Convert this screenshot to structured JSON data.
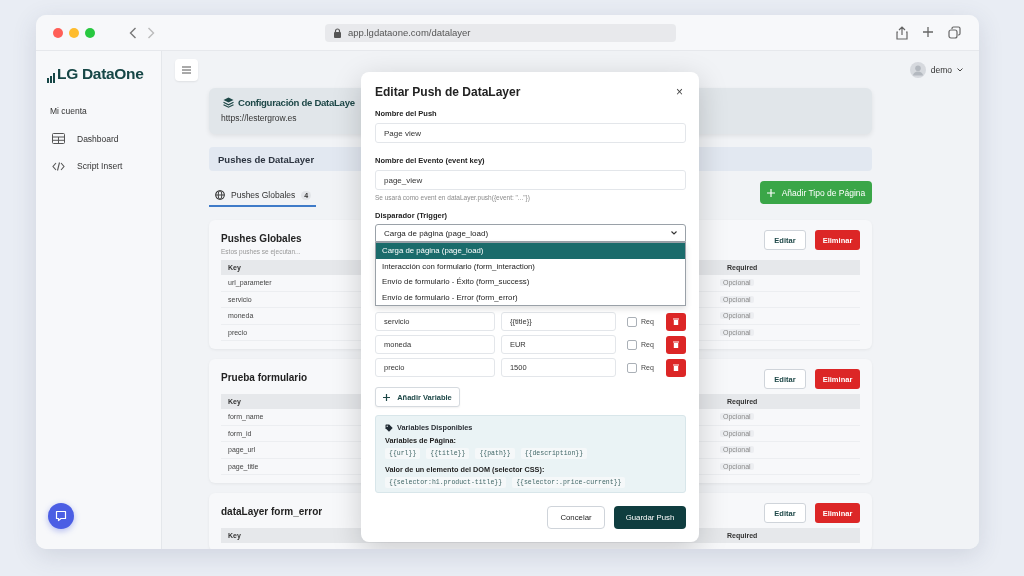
{
  "browser": {
    "url": "app.lgdataone.com/datalayer"
  },
  "sidebar": {
    "logo": "LG DataOne",
    "section": "Mi cuenta",
    "items": [
      {
        "label": "Dashboard"
      },
      {
        "label": "Script Insert"
      }
    ]
  },
  "user": {
    "name": "demo"
  },
  "header": {
    "title": "Configuración de DataLaye",
    "url": "https://lestergrow.es"
  },
  "section_title": "Pushes de DataLayer",
  "tabs": [
    {
      "label": "Pushes Globales",
      "count": "4",
      "selected": true
    }
  ],
  "add_page_type_button": "Añadir Tipo de Página",
  "cards": [
    {
      "title": "Pushes Globales",
      "subtitle": "Estos pushes se ejecutan...",
      "edit": "Editar",
      "delete": "Eliminar",
      "columns": [
        "Key",
        "Required"
      ],
      "rows": [
        {
          "key": "url_parameter",
          "required": "Opcional"
        },
        {
          "key": "servicio",
          "required": "Opcional"
        },
        {
          "key": "moneda",
          "required": "Opcional"
        },
        {
          "key": "precio",
          "required": "Opcional"
        }
      ]
    },
    {
      "title": "Prueba formulario",
      "edit": "Editar",
      "delete": "Eliminar",
      "columns": [
        "Key",
        "Required"
      ],
      "rows": [
        {
          "key": "form_name",
          "required": "Opcional"
        },
        {
          "key": "form_id",
          "required": "Opcional"
        },
        {
          "key": "page_url",
          "required": "Opcional"
        },
        {
          "key": "page_title",
          "required": "Opcional"
        }
      ]
    },
    {
      "title": "dataLayer form_error",
      "edit": "Editar",
      "delete": "Eliminar",
      "columns": [
        "Key",
        "Required"
      ]
    }
  ],
  "modal": {
    "title": "Editar Push de DataLayer",
    "close": "×",
    "push_name": {
      "label": "Nombre del Push",
      "value": "Page view"
    },
    "event_key": {
      "label": "Nombre del Evento (event key)",
      "value": "page_view",
      "hint": "Se usará como event en dataLayer.push({event: \"...\"})"
    },
    "trigger": {
      "label": "Disparador (Trigger)",
      "value": "Carga de página (page_load)",
      "expanded": true,
      "options": [
        {
          "label": "Carga de página (page_load)",
          "selected": true
        },
        {
          "label": "Interacción con formulario (form_interaction)",
          "selected": false
        },
        {
          "label": "Envío de formulario - Éxito (form_success)",
          "selected": false
        },
        {
          "label": "Envío de formulario - Error (form_error)",
          "selected": false
        }
      ]
    },
    "variables": [
      {
        "key": "servicio",
        "value": "{{title}}",
        "required": false,
        "required_label": "Req"
      },
      {
        "key": "moneda",
        "value": "EUR",
        "required": false,
        "required_label": "Req"
      },
      {
        "key": "precio",
        "value": "1500",
        "required": false,
        "required_label": "Req"
      }
    ],
    "add_variable": "Añadir Variable",
    "available": {
      "title": "Variables Disponibles",
      "page_label": "Variables de Página:",
      "page_vars": [
        "{{url}}",
        "{{title}}",
        "{{path}}",
        "{{description}}"
      ],
      "dom_label": "Valor de un elemento del DOM (selector CSS):",
      "dom_vars": [
        "{{selector:h1.product-title}}",
        "{{selector:.price-current}}"
      ]
    },
    "cancel": "Concelar",
    "save": "Guardar Push"
  }
}
